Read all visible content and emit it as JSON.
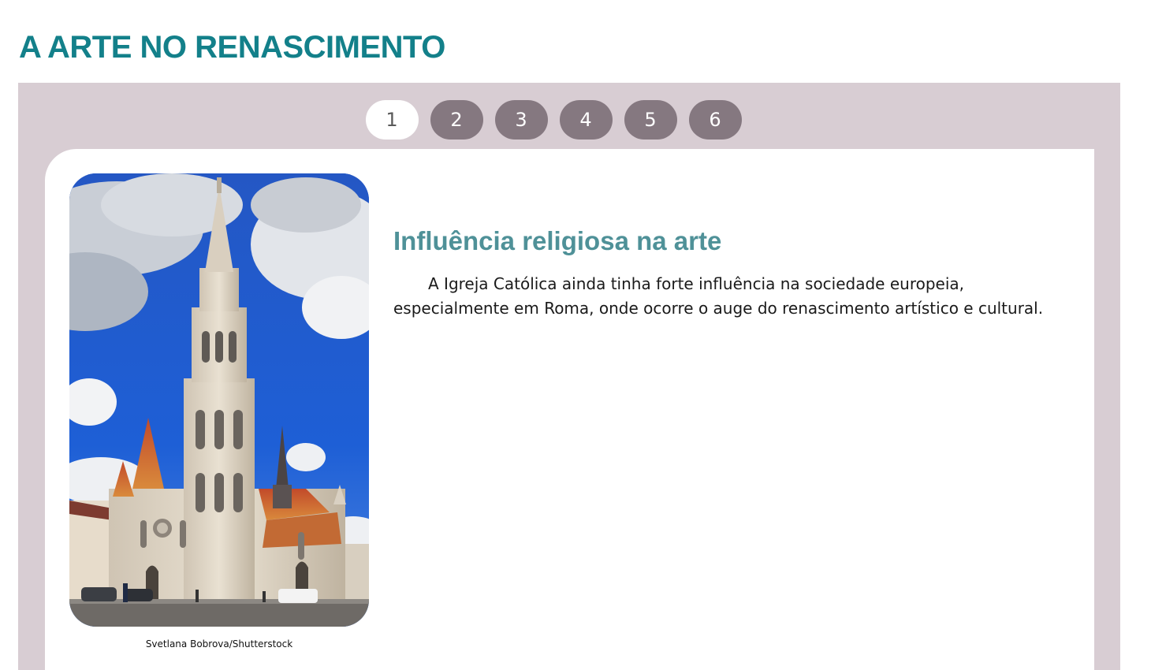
{
  "page": {
    "title": "A ARTE NO RENASCIMENTO"
  },
  "tabs": [
    {
      "label": "1",
      "active": true
    },
    {
      "label": "2",
      "active": false
    },
    {
      "label": "3",
      "active": false
    },
    {
      "label": "4",
      "active": false
    },
    {
      "label": "5",
      "active": false
    },
    {
      "label": "6",
      "active": false
    }
  ],
  "content": {
    "image_credit": "Svetlana Bobrova/Shutterstock",
    "heading": "Influência religiosa na arte",
    "paragraph": "A Igreja Católica ainda tinha forte influência na sociedade europeia, especialmente em Roma, onde ocorre o auge do renascimento artístico e cultural."
  },
  "colors": {
    "title": "#13808a",
    "panel_bg": "#d8cdd3",
    "tab_inactive": "#857880",
    "tab_active": "#ffffff",
    "heading": "#4f9198"
  }
}
